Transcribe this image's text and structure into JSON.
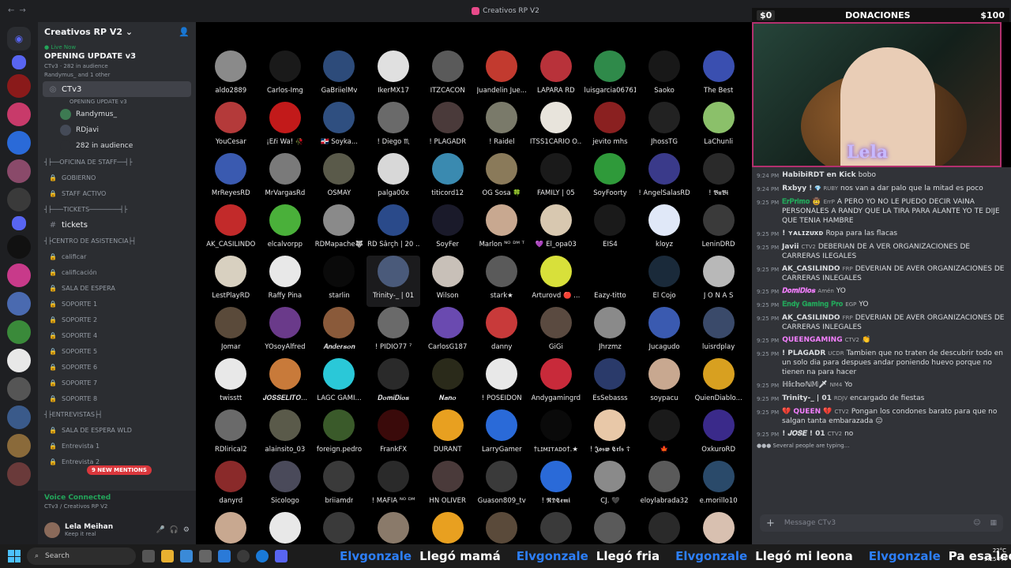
{
  "titlebar": {
    "title": "Creativos RP V2"
  },
  "server": {
    "name": "Creativos RP V2 ⌄"
  },
  "live": {
    "tag": "● Live Now",
    "title": "OPENING UPDATE v3",
    "meta1": "CTv3 · 282 in audience",
    "meta2": "Randymus_ and 1 other"
  },
  "stage_channel": {
    "name": "CTv3",
    "topic": "OPENING UPDATE v3"
  },
  "stage_users": [
    {
      "name": "Randymus_",
      "color": "#3d7a52"
    },
    {
      "name": "RDjavi",
      "color": "#444a57"
    },
    {
      "name": "282 in audience",
      "color": "#2b2d31"
    }
  ],
  "categories": {
    "staff": "┤├──OFICINA DE STAFF──┤├",
    "tickets": "┤├───TICKETS────────┤├",
    "asistencia": "┤├CENTRO DE ASISTENCIA├┤",
    "entrevistas": "┤├ENTREVISTAS├┤"
  },
  "staff_channels": [
    "GOBIERNO",
    "STAFF ACTIVO"
  ],
  "ticket_channel": "tickets",
  "assist_channels": [
    "calificar",
    "calificación",
    "SALA DE ESPERA",
    "SOPORTE 1",
    "SOPORTE 2",
    "SOPORTE 4",
    "SOPORTE 5",
    "SOPORTE 6",
    "SOPORTE 7",
    "SOPORTE 8"
  ],
  "entrev_channels": [
    "SALA DE ESPERA WLD",
    "Entrevista 1",
    "Entrevista 2"
  ],
  "mentions": "9 NEW MENTIONS",
  "voice": {
    "status": "Voice Connected",
    "where": "CTv3 / Creativos RP V2"
  },
  "user": {
    "name": "Lela Meihan",
    "status": "Keep it real"
  },
  "audience": [
    {
      "n": "aldo2889",
      "c": "#8a8a8a"
    },
    {
      "n": "Carlos-Img",
      "c": "#1a1a1a"
    },
    {
      "n": "GaBriielMv",
      "c": "#2d4b7a"
    },
    {
      "n": "IkerMX17",
      "c": "#e0e0e0"
    },
    {
      "n": "ITZCACON",
      "c": "#5a5a5a"
    },
    {
      "n": "Juandelin Jue...",
      "c": "#c23a2f"
    },
    {
      "n": "LAPARA RD",
      "c": "#b8323a"
    },
    {
      "n": "luisgarcia06761",
      "c": "#2f8a4a"
    },
    {
      "n": "Saoko",
      "c": "#181818"
    },
    {
      "n": "The Best",
      "c": "#3a4fb0"
    },
    {
      "n": "YouCesar",
      "c": "#b43a3a"
    },
    {
      "n": "¡Eℓi Wa! 🥀",
      "c": "#c21a1a"
    },
    {
      "n": "🇩🇴 Soyka...",
      "c": "#2f4f80"
    },
    {
      "n": "! Diego ♏",
      "c": "#6a6a6a"
    },
    {
      "n": "! PLAGADR",
      "c": "#4a3a3a"
    },
    {
      "n": "! Raidel",
      "c": "#7a7a6a"
    },
    {
      "n": "ITSS1CARIO O...",
      "c": "#e8e4dc"
    },
    {
      "n": "jevito mhs",
      "c": "#8a2020"
    },
    {
      "n": "JhossTG",
      "c": "#222"
    },
    {
      "n": "LaChunli",
      "c": "#8bc06a"
    },
    {
      "n": "MrReyesRD",
      "c": "#3a5ab0"
    },
    {
      "n": "MrVargasRd",
      "c": "#7a7a7a"
    },
    {
      "n": "OSMAY",
      "c": "#5a5a4a"
    },
    {
      "n": "palga00x",
      "c": "#d8d8d8"
    },
    {
      "n": "titicord12",
      "c": "#3a8ab0"
    },
    {
      "n": "OG Sosa 🍀",
      "c": "#8a7a5a"
    },
    {
      "n": "FAMILY | 05",
      "c": "#1a1a1a"
    },
    {
      "n": "SoyFoorty",
      "c": "#2f9a3a"
    },
    {
      "n": "! AngelSalasRD",
      "c": "#3a3a8a"
    },
    {
      "n": "! 𝕭𝖚𝕭𝖎",
      "c": "#2a2a2a"
    },
    {
      "n": "AK_CASILINDO",
      "c": "#c22a2a"
    },
    {
      "n": "elcalvorpp",
      "c": "#4ab03a"
    },
    {
      "n": "RDMapache🐺",
      "c": "#8a8a8a"
    },
    {
      "n": "RD Šârçh | 20 ...",
      "c": "#2a4a8a"
    },
    {
      "n": "SoyFer",
      "c": "#1a1a2a"
    },
    {
      "n": "Marlon ᴺᴼ ᴰᴹ ᵀ",
      "c": "#c8a890"
    },
    {
      "n": "💜 El_opa03",
      "c": "#d8c8b0"
    },
    {
      "n": "EIS4",
      "c": "#1a1a1a"
    },
    {
      "n": "kloyz",
      "c": "#e0e8f8"
    },
    {
      "n": "LeninDRD",
      "c": "#3a3a3a"
    },
    {
      "n": "LestPlayRD",
      "c": "#d8d0c0"
    },
    {
      "n": "Raffy Pina",
      "c": "#e8e8e8"
    },
    {
      "n": "starlin",
      "c": "#0a0a0a"
    },
    {
      "n": "Trinity-_ | 01",
      "c": "#4a5a7a"
    },
    {
      "n": "Wilson",
      "c": "#c8c0b8"
    },
    {
      "n": "stark★",
      "c": "#5a5a5a"
    },
    {
      "n": "Arturovd 🔴 ...",
      "c": "#d8e03a"
    },
    {
      "n": "Eazy-titto",
      "c": "#000"
    },
    {
      "n": "El Cojo",
      "c": "#1a2a3a"
    },
    {
      "n": "J O N A S",
      "c": "#b8b8b8"
    },
    {
      "n": "Jomar",
      "c": "#5a4a3a"
    },
    {
      "n": "YOsoyAlfred",
      "c": "#6a3a8a"
    },
    {
      "n": "𝑨𝒏𝒅𝒆𝒓𝒔𝒐𝒏",
      "c": "#8a5a3a"
    },
    {
      "n": "! PIDIO77 ⁷",
      "c": "#6a6a6a"
    },
    {
      "n": "CarlosG187",
      "c": "#6a4ab0"
    },
    {
      "n": "danny",
      "c": "#c83a3a"
    },
    {
      "n": "GiGi",
      "c": "#5a4a40"
    },
    {
      "n": "Jhrzmz",
      "c": "#8a8a8a"
    },
    {
      "n": "Jucagudo",
      "c": "#3a5ab0"
    },
    {
      "n": "luisrdplay",
      "c": "#3a4a6a"
    },
    {
      "n": "twisstt",
      "c": "#e8e8e8"
    },
    {
      "n": "𝑱𝑶𝑺𝑺𝑬𝑳𝑰𝑻𝑶...",
      "c": "#c87a3a"
    },
    {
      "n": "LAGC GAMI...",
      "c": "#2ac8d8"
    },
    {
      "n": "𝑫𝒐𝒎𝒊𝑫𝒊𝒐𝒔",
      "c": "#2a2a2a"
    },
    {
      "n": "𝑵𝒂𝒏𝒐",
      "c": "#2a2a1a"
    },
    {
      "n": "! POSEIDON",
      "c": "#e8e8e8"
    },
    {
      "n": "Andygamingrd",
      "c": "#c82a3a"
    },
    {
      "n": "EsSebasss",
      "c": "#2a3a6a"
    },
    {
      "n": "soypacu",
      "c": "#c8a890"
    },
    {
      "n": "QuienDiablo...",
      "c": "#d8a020"
    },
    {
      "n": "RDlirical2",
      "c": "#6a6a6a"
    },
    {
      "n": "alainsito_03",
      "c": "#5a5a4a"
    },
    {
      "n": "foreign.pedro",
      "c": "#3a5a2a"
    },
    {
      "n": "FrankFX",
      "c": "#3a0a0a"
    },
    {
      "n": "DURANT",
      "c": "#e8a020"
    },
    {
      "n": "LarryGamer",
      "c": "#2a6ad8"
    },
    {
      "n": "†ʟɪᴍɪᴛᴀᴅᴏ†.★",
      "c": "#0a0a0a"
    },
    {
      "n": "! 𝕵𝖔𝖘𝖜 𝕮𝖗𝖑𝖘 ☦",
      "c": "#e8c8a8"
    },
    {
      "n": "🍁",
      "c": "#1a1a1a"
    },
    {
      "n": "OxkuroRD",
      "c": "#3a2a8a"
    },
    {
      "n": "danyrd",
      "c": "#8a2a2a"
    },
    {
      "n": "Sicologo",
      "c": "#4a4a5a"
    },
    {
      "n": "briiamdr",
      "c": "#3a3a3a"
    },
    {
      "n": "! MAFIA ᴺᴼ ᴰᴹ",
      "c": "#2a2a2a"
    },
    {
      "n": "HN OLIVER",
      "c": "#4a3a3a"
    },
    {
      "n": "Guason809_tv",
      "c": "#3a3a3a"
    },
    {
      "n": "! 𝕽𝕯𝕮𝖊𝖒𝖎",
      "c": "#2a6ad8"
    },
    {
      "n": "CJ. 🖤",
      "c": "#8a8a8a"
    },
    {
      "n": "eloylabrada32",
      "c": "#5a5a5a"
    },
    {
      "n": "e.morillo10",
      "c": "#2a4a6a"
    },
    {
      "n": "",
      "c": "#c8a890"
    },
    {
      "n": "",
      "c": "#e8e8e8"
    },
    {
      "n": "",
      "c": "#3a3a3a"
    },
    {
      "n": "",
      "c": "#8a7a6a"
    },
    {
      "n": "",
      "c": "#e8a020"
    },
    {
      "n": "",
      "c": "#5a4a3a"
    },
    {
      "n": "",
      "c": "#3a3a3a"
    },
    {
      "n": "",
      "c": "#5a5a5a"
    },
    {
      "n": "",
      "c": "#2a2a2a"
    },
    {
      "n": "",
      "c": "#d8c0b0"
    }
  ],
  "donations": {
    "left": "$0",
    "label": "DONACIONES",
    "right": "$100"
  },
  "cam": {
    "logo": "Lela"
  },
  "chat": [
    {
      "t": "9:24 PM",
      "who": "HabibiRDT en Kick",
      "wc": "#dbdee1",
      "role": "",
      "text": "bobo"
    },
    {
      "t": "9:24 PM",
      "who": "Rxbyy !",
      "wc": "#dbdee1",
      "role": "💎 RUBY",
      "text": "nos van a dar palo que la mitad es poco"
    },
    {
      "t": "9:25 PM",
      "who": "𝐄𝐫𝐏𝐫𝐢𝐦𝐨 🤠",
      "wc": "#23a55a",
      "role": "ErrP",
      "text": "A PERO YO NO LE PUEDO DECIR VAINA PERSONALES A RANDY QUE LA TIRA PARA ALANTE YO TE DIJE QUE TENIA HAMBRE"
    },
    {
      "t": "9:25 PM",
      "who": "! ʏᴀʟɪᴢᴜxᴅ",
      "wc": "#dbdee1",
      "role": "",
      "text": "Ropa para las flacas"
    },
    {
      "t": "9:25 PM",
      "who": "Javii",
      "wc": "#dbdee1",
      "role": "CTV2",
      "text": "DEBERIAN DE A VER ORGANIZACIONES DE CARRERAS ILEGALES"
    },
    {
      "t": "9:25 PM",
      "who": "AK_CASILINDO",
      "wc": "#dbdee1",
      "role": "FRP",
      "text": "DEVERIAN DE AVER ORGANIZACIONES DE CARRERAS INLEGALES"
    },
    {
      "t": "9:25 PM",
      "who": "𝑫𝒐𝒎𝒊𝑫𝒊𝒐𝒔",
      "wc": "#f47fff",
      "role": "Amén",
      "text": "YO"
    },
    {
      "t": "9:25 PM",
      "who": "𝐄𝐧𝐝𝐲 𝐆𝐚𝐦𝐢𝐧𝐠 𝐏𝐫𝐨",
      "wc": "#23a55a",
      "role": "EGP",
      "text": "YO"
    },
    {
      "t": "9:25 PM",
      "who": "AK_CASILINDO",
      "wc": "#dbdee1",
      "role": "FRP",
      "text": "DEVERIAN DE AVER ORGANIZACIONES DE CARRERAS INLEGALES"
    },
    {
      "t": "9:25 PM",
      "who": "QUEENGAMING",
      "wc": "#f47fff",
      "role": "CTV2",
      "text": "👏"
    },
    {
      "t": "9:25 PM",
      "who": "! PLAGADR",
      "wc": "#dbdee1",
      "role": "UCDR",
      "text": "Tambien que no traten de descubrir todo en un solo dia para despues andar poniendo huevo porque no tienen na para hacer"
    },
    {
      "t": "9:25 PM",
      "who": "ℍ𝕚𝕔𝕙𝕠ℕ𝕄🗡",
      "wc": "#dbdee1",
      "role": "NM4",
      "text": "Yo"
    },
    {
      "t": "9:25 PM",
      "who": "Trinity-_ | 01",
      "wc": "#dbdee1",
      "role": "RDJV",
      "text": "encargado de fiestas"
    },
    {
      "t": "9:25 PM",
      "who": "💔 QUEEN 💔",
      "wc": "#f47fff",
      "role": "CTV2",
      "text": "Pongan los condones barato para que no salgan tanta embarazada 😑"
    },
    {
      "t": "9:25 PM",
      "who": "! 𝑱𝑶𝑺𝑬 ! 01",
      "wc": "#dbdee1",
      "role": "CTV2",
      "text": "no"
    }
  ],
  "typing": "●●● Several people are typing...",
  "compose": {
    "placeholder": "Message CTv3"
  },
  "taskbar": {
    "search": "Search"
  },
  "ticker": [
    {
      "user": "Elvgonzale",
      "text": "Llegó mamá"
    },
    {
      "user": "Elvgonzale",
      "text": "Llegó fria"
    },
    {
      "user": "Elvgonzale",
      "text": "Llegó mi leona"
    },
    {
      "user": "Elvgonzale",
      "text": "Pa esa leona"
    }
  ],
  "tray": {
    "temp": "22°C",
    "time": "9:25 PM"
  }
}
